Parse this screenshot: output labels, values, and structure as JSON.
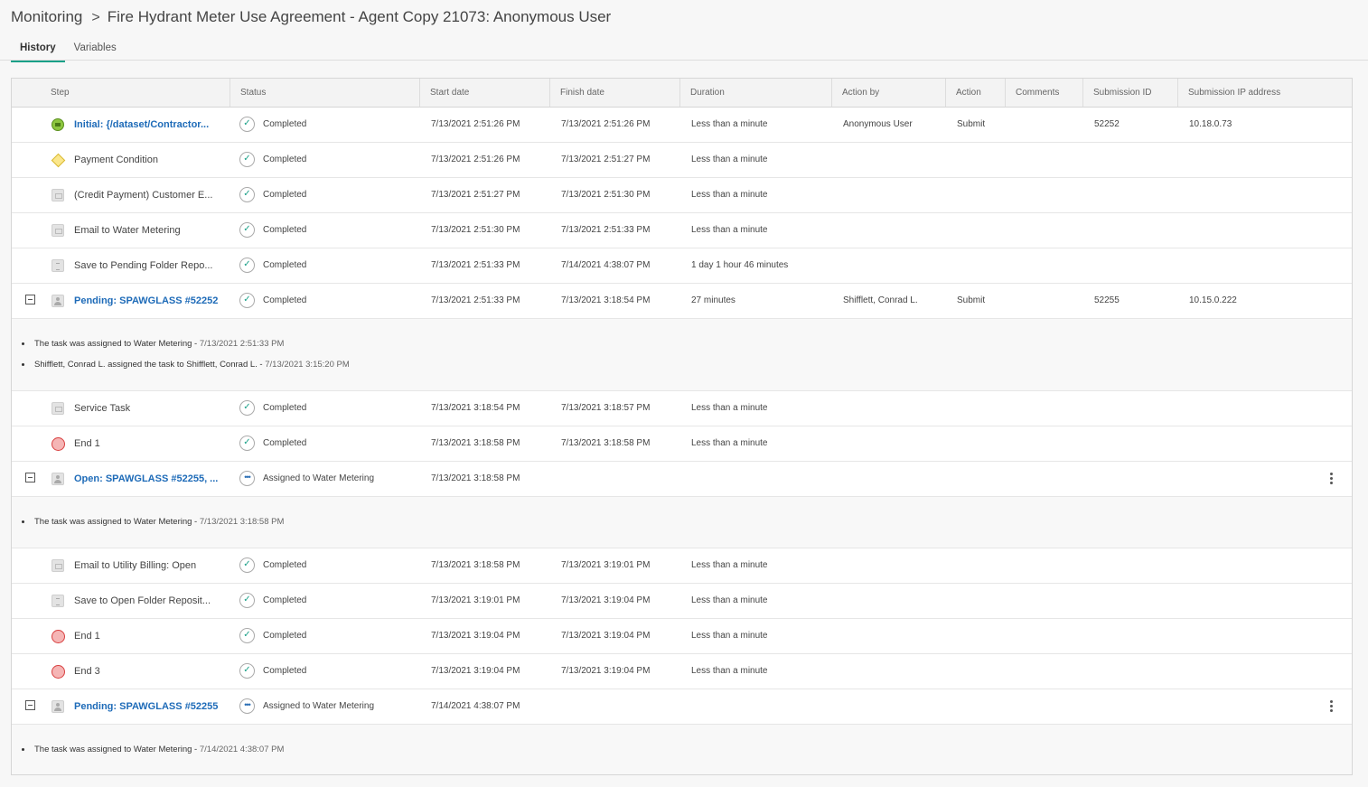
{
  "breadcrumb": {
    "root": "Monitoring",
    "separator": ">",
    "current": "Fire Hydrant Meter Use Agreement - Agent Copy 21073: Anonymous User"
  },
  "tabs": [
    {
      "label": "History",
      "active": true
    },
    {
      "label": "Variables",
      "active": false
    }
  ],
  "columns": [
    "Step",
    "Status",
    "Start date",
    "Finish date",
    "Duration",
    "Action by",
    "Action",
    "Comments",
    "Submission ID",
    "Submission IP address"
  ],
  "rows": [
    {
      "icon": "start-event-icon",
      "step": "Initial: {/dataset/Contractor...",
      "link": true,
      "status": "Completed",
      "start": "7/13/2021 2:51:26 PM",
      "finish": "7/13/2021 2:51:26 PM",
      "duration": "Less than a minute",
      "action_by": "Anonymous User",
      "action": "Submit",
      "submission_id": "52252",
      "ip": "10.18.0.73"
    },
    {
      "icon": "gateway-icon",
      "step": "Payment Condition",
      "status": "Completed",
      "start": "7/13/2021 2:51:26 PM",
      "finish": "7/13/2021 2:51:27 PM",
      "duration": "Less than a minute"
    },
    {
      "icon": "email-task-icon",
      "step": "(Credit Payment) Customer E...",
      "status": "Completed",
      "start": "7/13/2021 2:51:27 PM",
      "finish": "7/13/2021 2:51:30 PM",
      "duration": "Less than a minute"
    },
    {
      "icon": "email-task-icon",
      "step": "Email to Water Metering",
      "status": "Completed",
      "start": "7/13/2021 2:51:30 PM",
      "finish": "7/13/2021 2:51:33 PM",
      "duration": "Less than a minute"
    },
    {
      "icon": "document-task-icon",
      "step": "Save to Pending Folder Repo...",
      "status": "Completed",
      "start": "7/13/2021 2:51:33 PM",
      "finish": "7/14/2021 4:38:07 PM",
      "duration": "1 day 1 hour 46 minutes"
    },
    {
      "icon": "user-task-icon",
      "step": "Pending: SPAWGLASS #52252",
      "link": true,
      "expander": true,
      "status": "Completed",
      "start": "7/13/2021 2:51:33 PM",
      "finish": "7/13/2021 3:18:54 PM",
      "duration": "27 minutes",
      "action_by": "Shifflett, Conrad L.",
      "action": "Submit",
      "submission_id": "52255",
      "ip": "10.15.0.222",
      "details": [
        {
          "text": "The task was assigned to Water Metering - ",
          "ts": "7/13/2021 2:51:33 PM"
        },
        {
          "text": "Shifflett, Conrad L. assigned the task to Shifflett, Conrad L. - ",
          "ts": "7/13/2021 3:15:20 PM"
        }
      ]
    },
    {
      "icon": "email-task-icon",
      "step": "Service Task",
      "status": "Completed",
      "start": "7/13/2021 3:18:54 PM",
      "finish": "7/13/2021 3:18:57 PM",
      "duration": "Less than a minute"
    },
    {
      "icon": "end-event-icon",
      "step": "End 1",
      "status": "Completed",
      "start": "7/13/2021 3:18:58 PM",
      "finish": "7/13/2021 3:18:58 PM",
      "duration": "Less than a minute"
    },
    {
      "icon": "user-task-icon",
      "step": "Open: SPAWGLASS #52255, ...",
      "link": true,
      "expander": true,
      "pending": true,
      "menu": true,
      "status": "Assigned to Water Metering",
      "start": "7/13/2021 3:18:58 PM",
      "details": [
        {
          "text": "The task was assigned to Water Metering - ",
          "ts": "7/13/2021 3:18:58 PM"
        }
      ]
    },
    {
      "icon": "email-task-icon",
      "step": "Email to Utility Billing: Open",
      "status": "Completed",
      "start": "7/13/2021 3:18:58 PM",
      "finish": "7/13/2021 3:19:01 PM",
      "duration": "Less than a minute"
    },
    {
      "icon": "document-task-icon",
      "step": "Save to Open Folder Reposit...",
      "status": "Completed",
      "start": "7/13/2021 3:19:01 PM",
      "finish": "7/13/2021 3:19:04 PM",
      "duration": "Less than a minute"
    },
    {
      "icon": "end-event-icon",
      "step": "End 1",
      "status": "Completed",
      "start": "7/13/2021 3:19:04 PM",
      "finish": "7/13/2021 3:19:04 PM",
      "duration": "Less than a minute"
    },
    {
      "icon": "end-event-icon",
      "step": "End 3",
      "status": "Completed",
      "start": "7/13/2021 3:19:04 PM",
      "finish": "7/13/2021 3:19:04 PM",
      "duration": "Less than a minute"
    },
    {
      "icon": "user-task-icon",
      "step": "Pending: SPAWGLASS #52255",
      "link": true,
      "expander": true,
      "pending": true,
      "menu": true,
      "status": "Assigned to Water Metering",
      "start": "7/14/2021 4:38:07 PM",
      "details": [
        {
          "text": "The task was assigned to Water Metering - ",
          "ts": "7/14/2021 4:38:07 PM"
        }
      ]
    }
  ],
  "icons": {
    "completed": "check-icon",
    "pending": "ellipsis-icon",
    "menu": "kebab-menu-icon"
  },
  "colors": {
    "accent": "#1aa088",
    "link": "#1e6bb8"
  }
}
